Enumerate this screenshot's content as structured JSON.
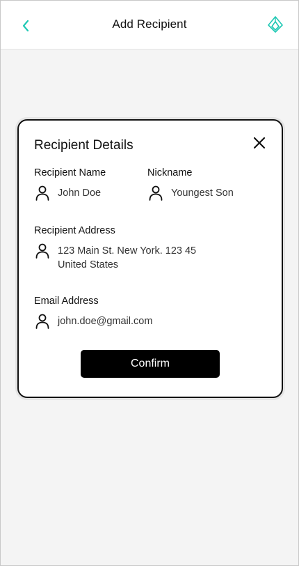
{
  "header": {
    "title": "Add Recipient",
    "back_icon": "chevron-left-icon",
    "logo_icon": "brand-logo-icon",
    "accent_color": "#1fc8b4"
  },
  "modal": {
    "title": "Recipient Details",
    "close_icon": "close-icon",
    "fields": {
      "recipient_name": {
        "label": "Recipient Name",
        "value": "John Doe",
        "icon": "person-icon"
      },
      "nickname": {
        "label": "Nickname",
        "value": "Youngest Son",
        "icon": "person-icon"
      },
      "address": {
        "label": "Recipient Address",
        "value_line1": "123 Main St. New York. 123 45",
        "value_line2": "United States",
        "icon": "person-icon"
      },
      "email": {
        "label": "Email Address",
        "value": "john.doe@gmail.com",
        "icon": "person-icon"
      }
    },
    "confirm_label": "Confirm"
  }
}
